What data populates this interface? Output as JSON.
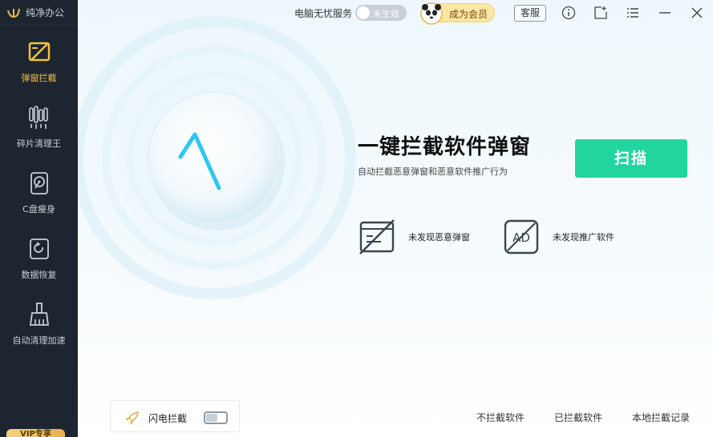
{
  "app": {
    "name": "纯净办公"
  },
  "sidebar": {
    "items": [
      {
        "label": "弹窗拦截",
        "icon": "popup-block-icon",
        "active": true
      },
      {
        "label": "碎片清理王",
        "icon": "fragment-clean-icon"
      },
      {
        "label": "C盘瘦身",
        "icon": "disk-slim-icon"
      },
      {
        "label": "数据恢复",
        "icon": "data-recovery-icon"
      },
      {
        "label": "自动清理加速",
        "icon": "auto-clean-icon"
      }
    ],
    "vip_badge": "VIP专享"
  },
  "topbar": {
    "service_label": "电脑无忧服务",
    "service_toggle_text": "未生效",
    "member_label": "成为会员",
    "support_label": "客服",
    "icons": [
      "info-icon",
      "feedback-icon",
      "menu-icon",
      "minimize-icon",
      "close-icon"
    ]
  },
  "hero": {
    "title": "一键拦截软件弹窗",
    "subtitle": "自动拦截恶意弹窗和恶意软件推广行为",
    "scan_label": "扫描"
  },
  "status": [
    {
      "label": "未发现恶意弹窗",
      "icon": "popup-window-icon"
    },
    {
      "label": "未发现推广软件",
      "icon": "ad-icon"
    }
  ],
  "footer": {
    "flash_label": "闪电拦截",
    "links": [
      "不拦截软件",
      "已拦截软件",
      "本地拦截记录"
    ]
  },
  "colors": {
    "sidebar_bg": "#1d2630",
    "accent": "#f4c23b",
    "scan_button": "#22d49e",
    "pulse": "#2ec7f0"
  }
}
